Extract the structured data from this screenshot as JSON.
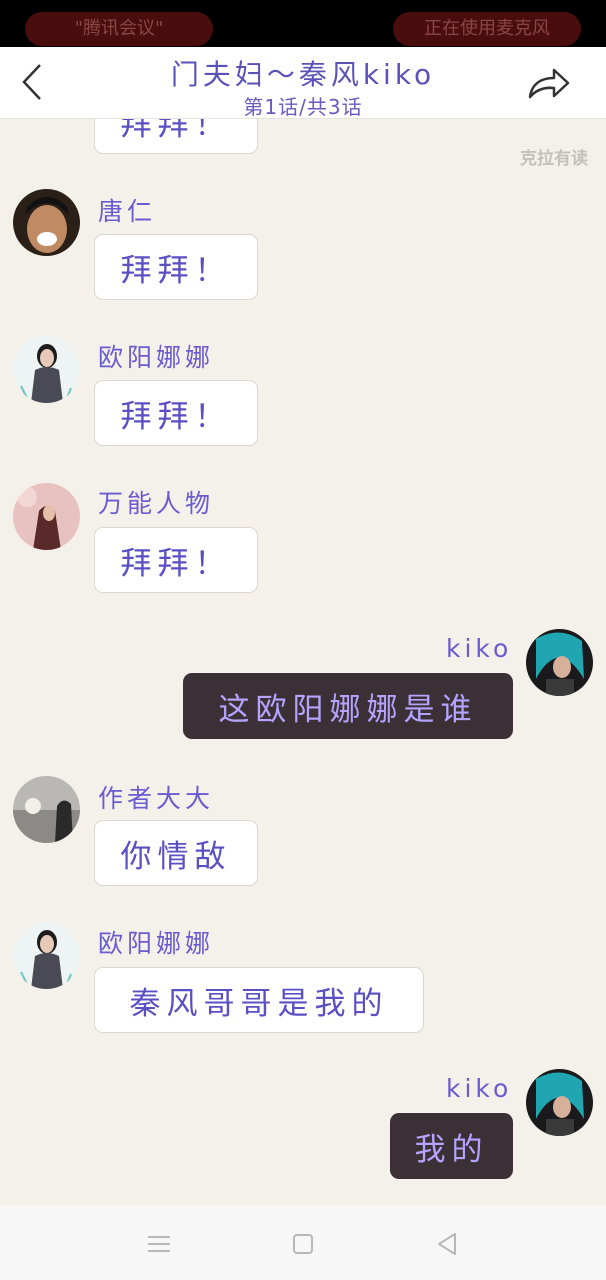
{
  "status_bar": {
    "left_pill": "\"腾讯会议\"",
    "right_pill": "正在使用麦克风"
  },
  "header": {
    "title": "门夫妇～秦风kiko",
    "subtitle": "第1话/共3话",
    "back_icon": "chevron-left-icon",
    "share_icon": "share-arrow-icon"
  },
  "watermark": "克拉有读",
  "messages": [
    {
      "side": "left",
      "sender": "",
      "text": "拜拜！"
    },
    {
      "side": "left",
      "sender": "唐仁",
      "text": "拜拜！",
      "avatar": "avatar-tangren"
    },
    {
      "side": "left",
      "sender": "欧阳娜娜",
      "text": "拜拜！",
      "avatar": "avatar-ouyangnana"
    },
    {
      "side": "left",
      "sender": "万能人物",
      "text": "拜拜！",
      "avatar": "avatar-wanneng"
    },
    {
      "side": "right",
      "sender": "kiko",
      "text": "这欧阳娜娜是谁",
      "avatar": "avatar-kiko"
    },
    {
      "side": "left",
      "sender": "作者大大",
      "text": "你情敌",
      "avatar": "avatar-author"
    },
    {
      "side": "left",
      "sender": "欧阳娜娜",
      "text": "秦风哥哥是我的",
      "avatar": "avatar-ouyangnana"
    },
    {
      "side": "right",
      "sender": "kiko",
      "text": "我的",
      "avatar": "avatar-kiko"
    }
  ],
  "nav_bar": {
    "menu_icon": "menu-icon",
    "home_icon": "home-square-icon",
    "back_icon": "back-triangle-icon"
  },
  "colors": {
    "background": "#f4f0ea",
    "name_text": "#6b5bd0",
    "bubble_in": "#ffffff",
    "bubble_out": "#3b3035"
  }
}
